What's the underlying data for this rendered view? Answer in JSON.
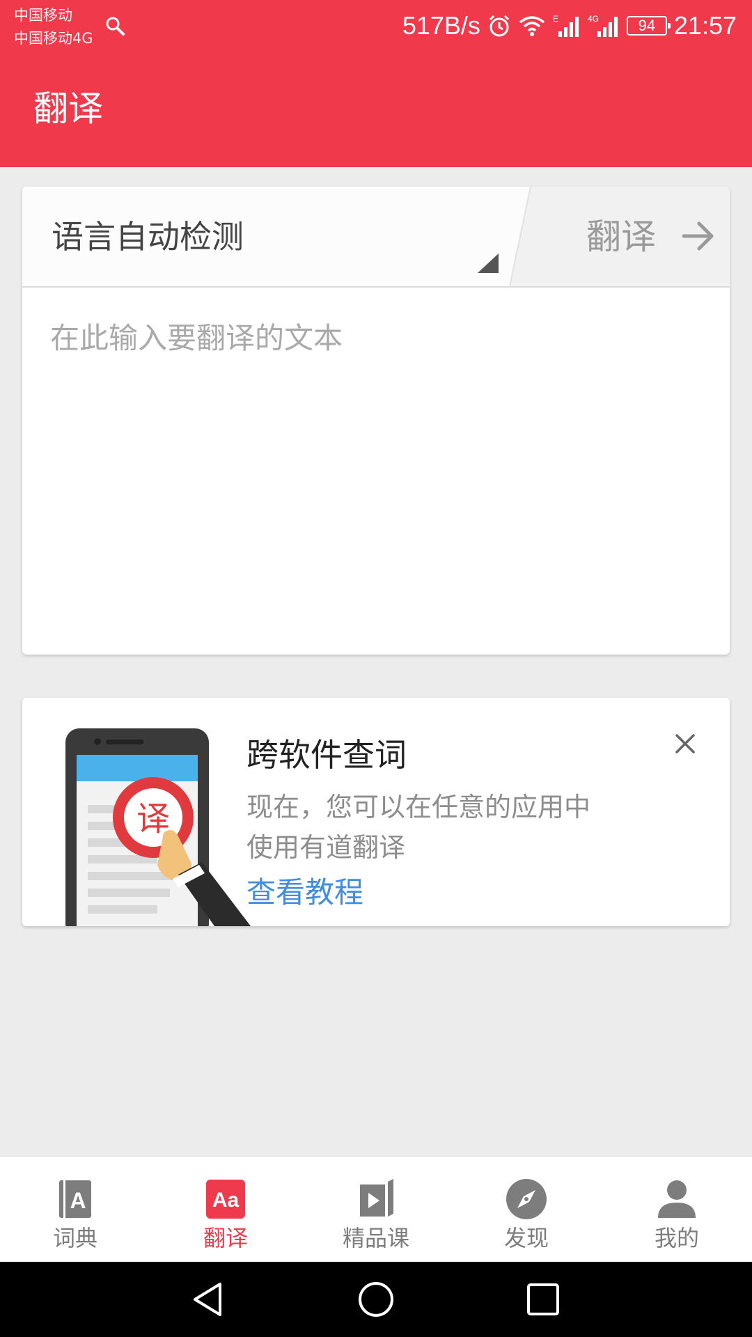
{
  "status_bar": {
    "carrier_1": "中国移动",
    "carrier_2": "中国移动4G",
    "net_speed": "517B/s",
    "battery": "94",
    "time": "21:57",
    "icons": [
      "search-icon",
      "alarm-icon",
      "wifi-icon",
      "signal-e-icon",
      "signal-4g-icon",
      "battery-icon"
    ]
  },
  "header": {
    "title": "翻译",
    "color": "#f0394b"
  },
  "translate_card": {
    "language_label": "语言自动检测",
    "translate_button": "翻译",
    "input_placeholder": "在此输入要翻译的文本",
    "input_value": ""
  },
  "promo": {
    "title": "跨软件查词",
    "description_line1": "现在，您可以在任意的应用中",
    "description_line2": "使用有道翻译",
    "link": "查看教程",
    "illustration_badge": "译",
    "link_color": "#3f8ee0"
  },
  "bottom_nav": {
    "items": [
      {
        "label": "词典",
        "icon": "dictionary-icon",
        "glyph": "A",
        "active": false
      },
      {
        "label": "翻译",
        "icon": "translate-icon",
        "glyph": "Aa",
        "active": true
      },
      {
        "label": "精品课",
        "icon": "course-video-icon",
        "active": false
      },
      {
        "label": "发现",
        "icon": "compass-icon",
        "active": false
      },
      {
        "label": "我的",
        "icon": "person-icon",
        "active": false
      }
    ],
    "active_color": "#ee3a4c",
    "inactive_color": "#7d7d7d"
  },
  "system_nav": {
    "icons": [
      "back-icon",
      "home-icon",
      "recents-icon"
    ]
  }
}
